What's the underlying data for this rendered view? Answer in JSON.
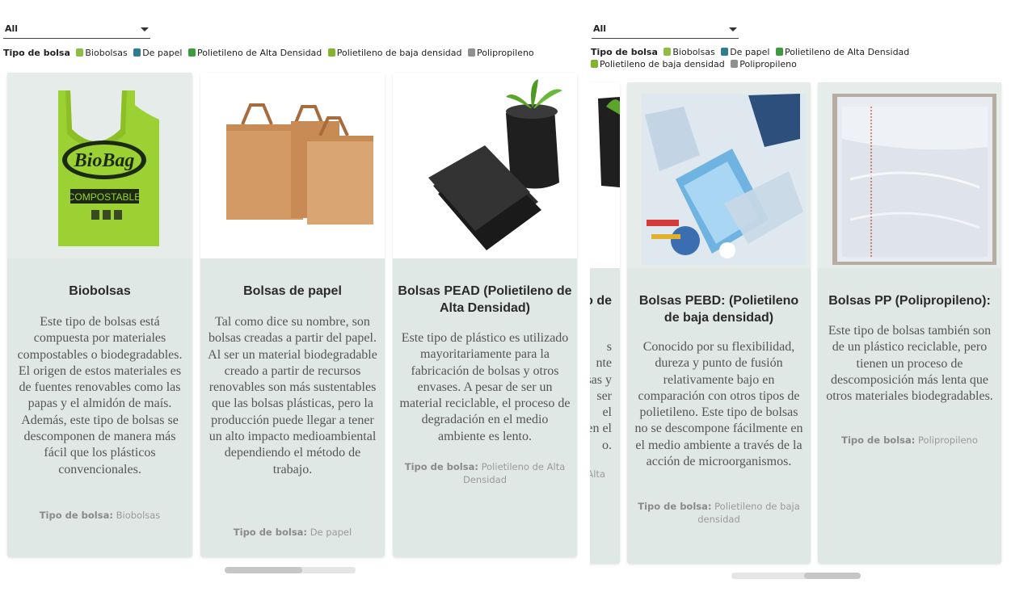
{
  "filter": {
    "value": "All"
  },
  "legend": {
    "title": "Tipo de bolsa",
    "items": [
      {
        "label": "Biobolsas",
        "color": "#8dbd45"
      },
      {
        "label": "De papel",
        "color": "#2e7d92"
      },
      {
        "label": "Polietileno de Alta Densidad",
        "color": "#3e9a3c"
      },
      {
        "label": "Polietileno de baja densidad",
        "color": "#86b232"
      },
      {
        "label": "Polipropileno",
        "color": "#8f8f8f"
      }
    ]
  },
  "cards": {
    "biobolsas": {
      "title": "Biobolsas",
      "description": "Este tipo de bolsas está compuesta por materiales compostables o biodegradables. El origen de estos materiales es de fuentes renovables como las papas y el almidón de maís. Además, este tipo de bolsas se descomponen de manera más fácil que los plásticos convencionales.",
      "meta_label": "Tipo de bolsa:",
      "meta_value": "Biobolsas",
      "image_text": {
        "brand": "BioBag",
        "tag": "COMPOSTABLE"
      }
    },
    "papel": {
      "title": "Bolsas de papel",
      "description": "Tal como dice su nombre, son bolsas creadas a partir del papel. Al ser un material biodegradable creado a partir de recursos renovables son más sustentables que las bolsas plásticas, pero la producción puede llegar a tener un alto impacto medioambiental dependiendo el método de trabajo.",
      "meta_label": "Tipo de bolsa:",
      "meta_value": "De papel"
    },
    "pead": {
      "title": "Bolsas PEAD (Polietileno de Alta Densidad)",
      "description": "Este tipo de plástico es utilizado mayoritariamente para la fabricación de bolsas y otros envases. A pesar de ser un material reciclable, el proceso de degradación en el medio ambiente es lento.",
      "meta_label": "Tipo de bolsa:",
      "meta_value": "Polietileno de Alta Densidad"
    },
    "pead_partial": {
      "title": "o de",
      "lines": [
        "s",
        "nte",
        "sas y",
        "ser",
        "el",
        "en el",
        "o."
      ],
      "meta_value": "Alta"
    },
    "pebd": {
      "title": "Bolsas PEBD: (Polietileno de baja densidad)",
      "description": "Conocido por su flexibilidad, dureza y punto de fusión relativamente bajo en comparación con otros tipos de polietileno. Este tipo de bolsas no se descompone fácilmente en el medio ambiente a través de la acción de microorganismos.",
      "meta_label": "Tipo de bolsa:",
      "meta_value": "Polietileno de baja densidad"
    },
    "pp": {
      "title": "Bolsas PP (Polipropileno):",
      "description": "Este tipo de bolsas también son de un plástico reciclable, pero tienen un proceso de descomposición más lenta que otros materiales biodegradables.",
      "meta_label": "Tipo de bolsa:",
      "meta_value": "Polipropileno"
    }
  },
  "scroll": {
    "left_position": 0.38,
    "right_position": 0.56
  }
}
